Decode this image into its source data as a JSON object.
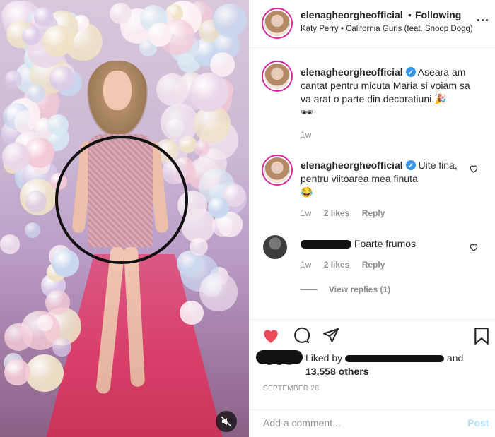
{
  "header": {
    "username": "elenagheorgheofficial",
    "separator": "•",
    "follow_state": "Following",
    "audio": "Katy Perry • California Gurls (feat. Snoop Dogg)",
    "more": "..."
  },
  "comments": [
    {
      "username": "elenagheorgheofficial",
      "verified": true,
      "text": "Aseara am cantat pentru micuta Maria si voiam sa va arat o parte din decoratiuni.🎉",
      "text_line2": "🕶",
      "time": "1w"
    },
    {
      "username": "elenagheorgheofficial",
      "verified": true,
      "text": "Uite fina, pentru viitoarea mea finuta",
      "emoji": "😂",
      "time": "1w",
      "likes": "2 likes",
      "reply": "Reply"
    },
    {
      "text": "Foarte frumos",
      "time": "1w",
      "likes": "2 likes",
      "reply": "Reply",
      "view_replies": "View replies (1)"
    }
  ],
  "liked": {
    "prefix": "Liked by",
    "suffix": "and",
    "count": "13,558 others"
  },
  "date": "SEPTEMBER 28",
  "composer": {
    "placeholder": "Add a comment...",
    "post_label": "Post"
  },
  "colors": {
    "like_red": "#ed4956",
    "verified_blue": "#3897f0",
    "post_disabled": "#b2dffc"
  }
}
